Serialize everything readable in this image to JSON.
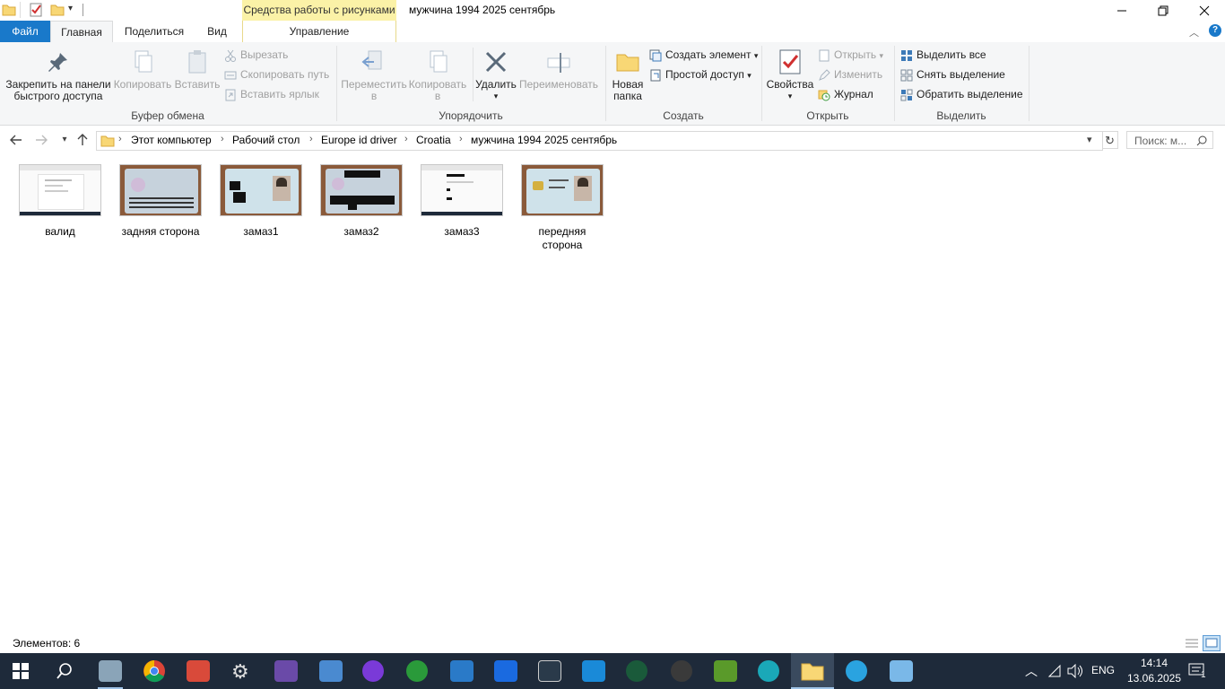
{
  "window": {
    "title": "мужчина 1994 2025 сентябрь",
    "context_tab_header": "Средства работы с рисунками",
    "controls": {
      "minimize": "—",
      "restore": "❐",
      "close": "✕"
    }
  },
  "tabs": {
    "file": "Файл",
    "home": "Главная",
    "share": "Поделиться",
    "view": "Вид",
    "manage": "Управление"
  },
  "ribbon": {
    "clipboard": {
      "label": "Буфер обмена",
      "pin": "Закрепить на панели быстрого доступа",
      "pin_line1": "Закрепить на панели",
      "pin_line2": "быстрого доступа",
      "copy": "Копировать",
      "paste": "Вставить",
      "cut": "Вырезать",
      "copy_path": "Скопировать путь",
      "paste_shortcut": "Вставить ярлык"
    },
    "organize": {
      "label": "Упорядочить",
      "move_line1": "Переместить",
      "move_line2": "в",
      "copy_line1": "Копировать",
      "copy_line2": "в",
      "delete": "Удалить",
      "rename": "Переименовать"
    },
    "new": {
      "label": "Создать",
      "new_folder_line1": "Новая",
      "new_folder_line2": "папка",
      "new_item": "Создать элемент",
      "easy_access": "Простой доступ"
    },
    "open": {
      "label": "Открыть",
      "properties": "Свойства",
      "open": "Открыть",
      "edit": "Изменить",
      "history": "Журнал"
    },
    "select": {
      "label": "Выделить",
      "select_all": "Выделить все",
      "select_none": "Снять выделение",
      "invert": "Обратить выделение"
    }
  },
  "navigation": {
    "breadcrumb": [
      "Этот компьютер",
      "Рабочий стол",
      "Europe id driver",
      "Croatia",
      "мужчина 1994 2025 сентябрь"
    ],
    "search_placeholder": "Поиск: м..."
  },
  "files": [
    {
      "name": "валид",
      "thumb": "document"
    },
    {
      "name": "задняя сторона",
      "thumb": "id-back"
    },
    {
      "name": "замаз1",
      "thumb": "id-front-redacted"
    },
    {
      "name": "замаз2",
      "thumb": "id-back-redacted"
    },
    {
      "name": "замаз3",
      "thumb": "document-redacted"
    },
    {
      "name": "передняя сторона",
      "thumb": "id-front"
    }
  ],
  "status": {
    "item_count": "Элементов: 6"
  },
  "taskbar": {
    "lang": "ENG",
    "time": "14:14",
    "date": "13.06.2025",
    "notifications": "1"
  },
  "colors": {
    "file_tab": "#1979ca",
    "context_tab": "#fbf2a7",
    "taskbar": "#1e2a3a"
  }
}
